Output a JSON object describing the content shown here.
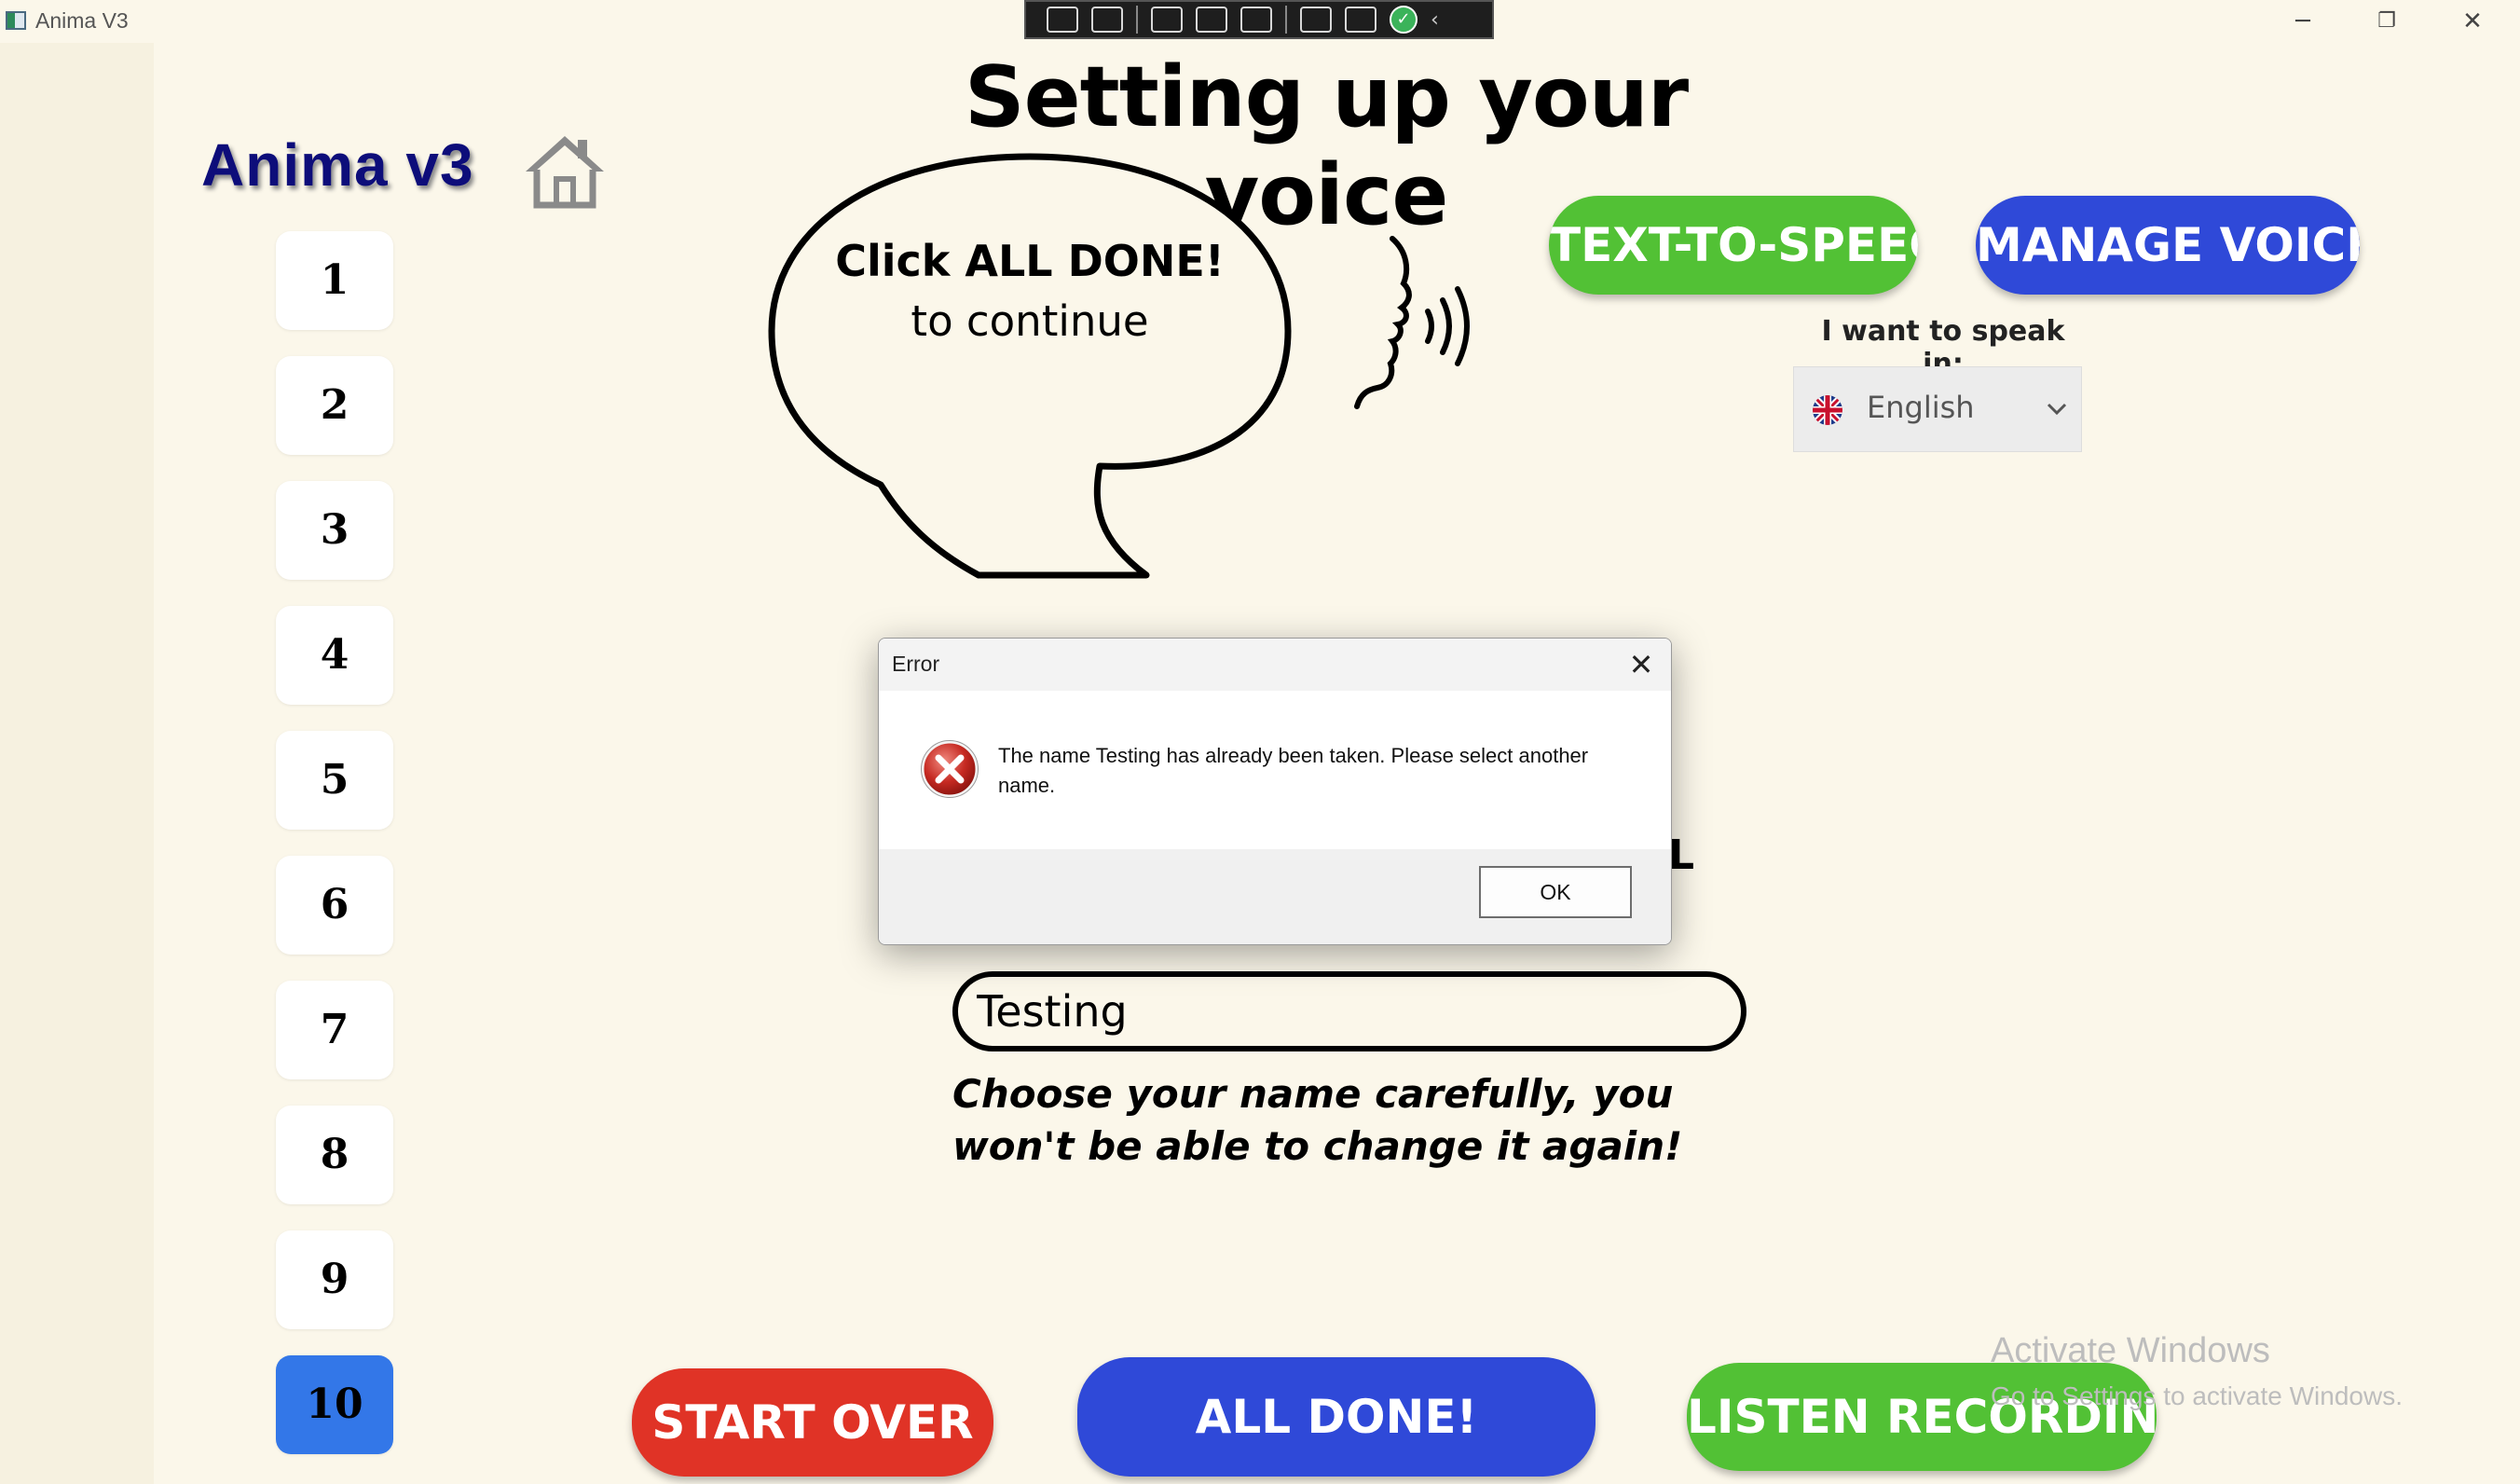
{
  "window": {
    "title": "Anima V3",
    "minimize": "─",
    "restore": "❐",
    "close": "✕"
  },
  "brand": "Anima v3",
  "steps": [
    "1",
    "2",
    "3",
    "4",
    "5",
    "6",
    "7",
    "8",
    "9",
    "10"
  ],
  "active_step": "10",
  "page_title": "Setting up your voice",
  "bubble": {
    "line1": "Click ALL DONE!",
    "line2": "to continue"
  },
  "buttons": {
    "tts": "TEXT-TO-SPEECH",
    "manage_voices": "MANAGE VOICES",
    "start_over": "START OVER",
    "all_done": "ALL DONE!",
    "listen_recording": "LISTEN RECORDING"
  },
  "language": {
    "label": "I want to speak in:",
    "selected": "English",
    "flag_icon": "uk-flag-icon"
  },
  "partial_text": "L",
  "name_input": {
    "value": "Testing"
  },
  "hint": "Choose your name carefully, you won't be able to change it again!",
  "watermark": {
    "line1": "Activate Windows",
    "line2": "Go to Settings to activate Windows."
  },
  "dialog": {
    "title": "Error",
    "close": "✕",
    "message": "The name Testing has already been taken. Please select another name.",
    "ok": "OK",
    "icon": "error-icon"
  },
  "colors": {
    "background": "#fbf7ea",
    "green": "#52c135",
    "blue": "#2f49d8",
    "red": "#e03326",
    "active_step": "#3377e8",
    "brand": "#0d0d7a"
  }
}
